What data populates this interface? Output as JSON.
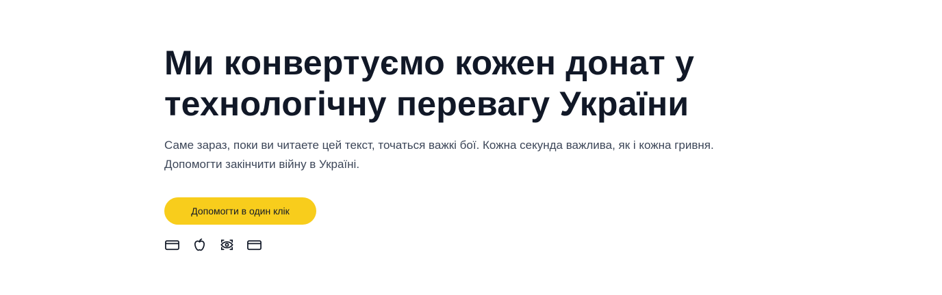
{
  "hero": {
    "title": "Ми конвертуємо кожен донат у технологічну перевагу України",
    "subtitle": "Саме зараз, поки ви читаете цей текст, точаться важкі бої. Кожна секунда важлива, як і кожна гривня. Допомогти закінчити війну в Україні.",
    "cta_label": "Допомогти в один клік"
  },
  "payment_methods": [
    {
      "icon": "credit-card-icon"
    },
    {
      "icon": "apple-icon"
    },
    {
      "icon": "eye-icon"
    },
    {
      "icon": "credit-card-icon"
    }
  ],
  "colors": {
    "accent": "#f8cd1c",
    "title": "#111827",
    "text": "#3c4658"
  }
}
